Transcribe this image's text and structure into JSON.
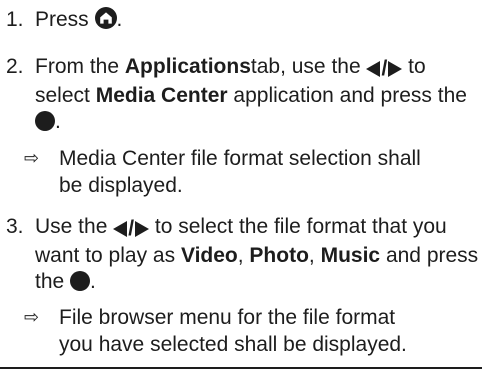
{
  "steps": [
    {
      "number": "1.",
      "parts": [
        "Press",
        "."
      ]
    },
    {
      "number": "2.",
      "parts": [
        "From the",
        "Applications",
        "tab, use the",
        "to select",
        "Media Center",
        "application and",
        "press the",
        "."
      ]
    },
    {
      "result": true,
      "arrow": "⇨",
      "parts": [
        "Media Center file format selection shall",
        "be displayed."
      ]
    },
    {
      "number": "3.",
      "parts": [
        "Use the",
        "to select the file format",
        "that you want to play as",
        "Video",
        ",",
        "Photo",
        ",",
        "Music",
        "and press the",
        "."
      ]
    },
    {
      "result": true,
      "arrow": "⇨",
      "parts": [
        "File browser menu for the file format",
        "you have selected shall be displayed."
      ]
    }
  ],
  "icons": {
    "home": "home-icon",
    "ok": "ok-button-icon",
    "left_right": "left-right-arrows-icon",
    "left_right_separator": "/"
  },
  "colors": {
    "text": "#1d1d1d"
  }
}
